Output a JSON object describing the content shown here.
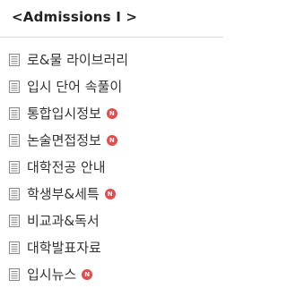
{
  "header": {
    "title": "<Admissions  I >"
  },
  "menu": {
    "items": [
      {
        "label": "로&물 라이브러리",
        "icon": "document-icon",
        "is_new": false
      },
      {
        "label": "입시 단어 속풀이",
        "icon": "document-icon",
        "is_new": false
      },
      {
        "label": "통합입시정보",
        "icon": "document-icon",
        "is_new": true
      },
      {
        "label": "논술면접정보",
        "icon": "document-icon",
        "is_new": true
      },
      {
        "label": "대학전공 안내",
        "icon": "document-icon",
        "is_new": false
      },
      {
        "label": "학생부&세특",
        "icon": "document-icon",
        "is_new": true
      },
      {
        "label": "비교과&독서",
        "icon": "document-icon",
        "is_new": false
      },
      {
        "label": "대학발표자료",
        "icon": "document-icon",
        "is_new": false
      },
      {
        "label": "입시뉴스",
        "icon": "document-icon",
        "is_new": true
      }
    ],
    "new_badge_text": "N",
    "badge_color": "#e84b4b",
    "icon_color": "#8a8a8a"
  }
}
